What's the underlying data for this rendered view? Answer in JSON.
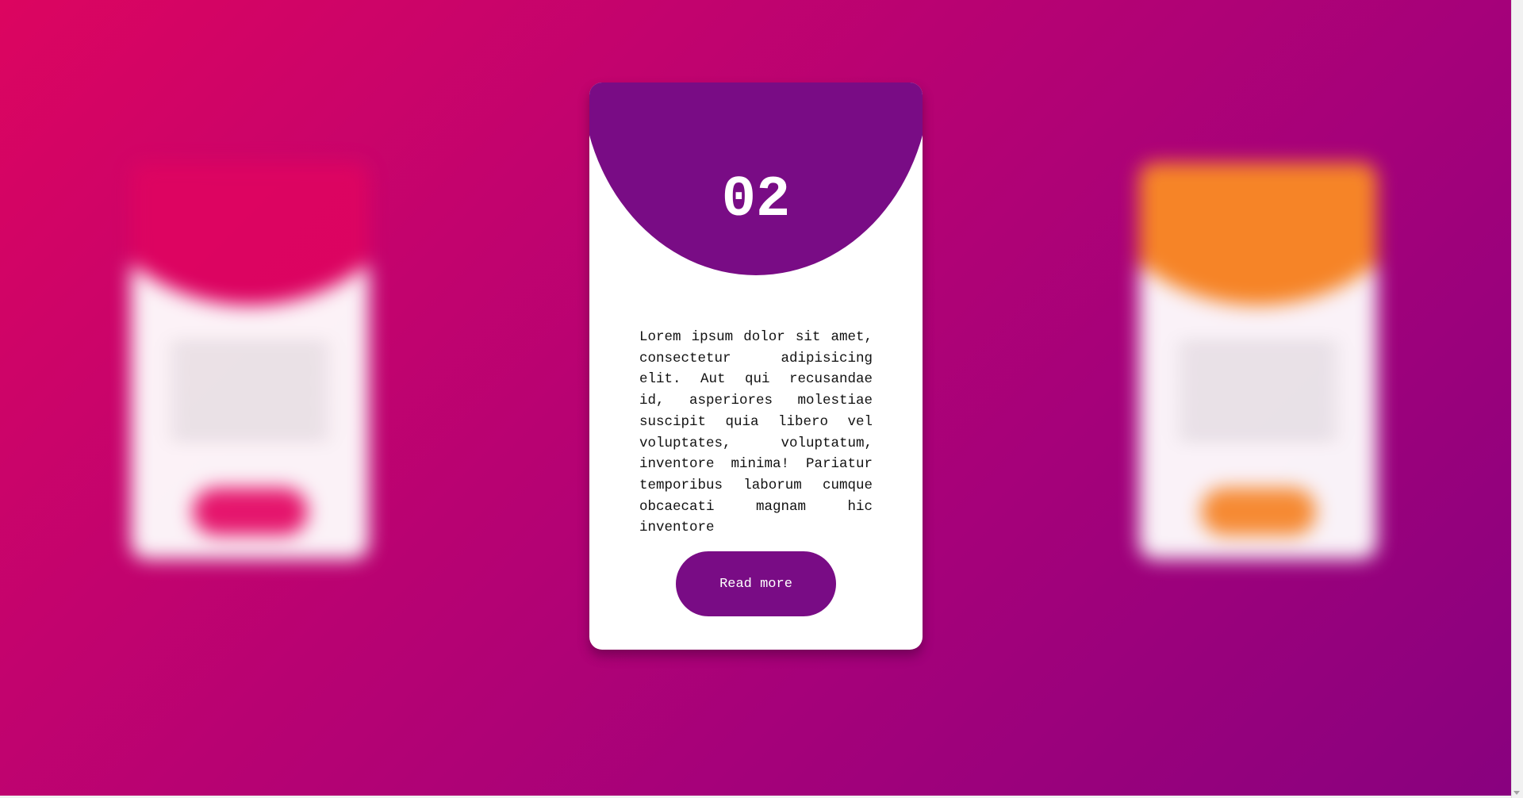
{
  "cards": [
    {
      "position": "left",
      "number": "",
      "accent": "#de0461",
      "button_label": "",
      "blurred": true
    },
    {
      "position": "center",
      "number": "02",
      "accent": "#790c85",
      "description": "Lorem ipsum dolor sit amet, consectetur adipisicing elit. Aut qui recusandae id, asperiores molestiae suscipit quia libero vel voluptates, voluptatum, inventore minima! Pariatur temporibus laborum cumque obcaecati magnam hic inventore",
      "button_label": "Read more",
      "blurred": false
    },
    {
      "position": "right",
      "number": "",
      "accent": "#fb8c23",
      "button_label": "",
      "blurred": true
    }
  ],
  "background": {
    "gradient_start": "#dc0560",
    "gradient_end": "#88017f"
  }
}
